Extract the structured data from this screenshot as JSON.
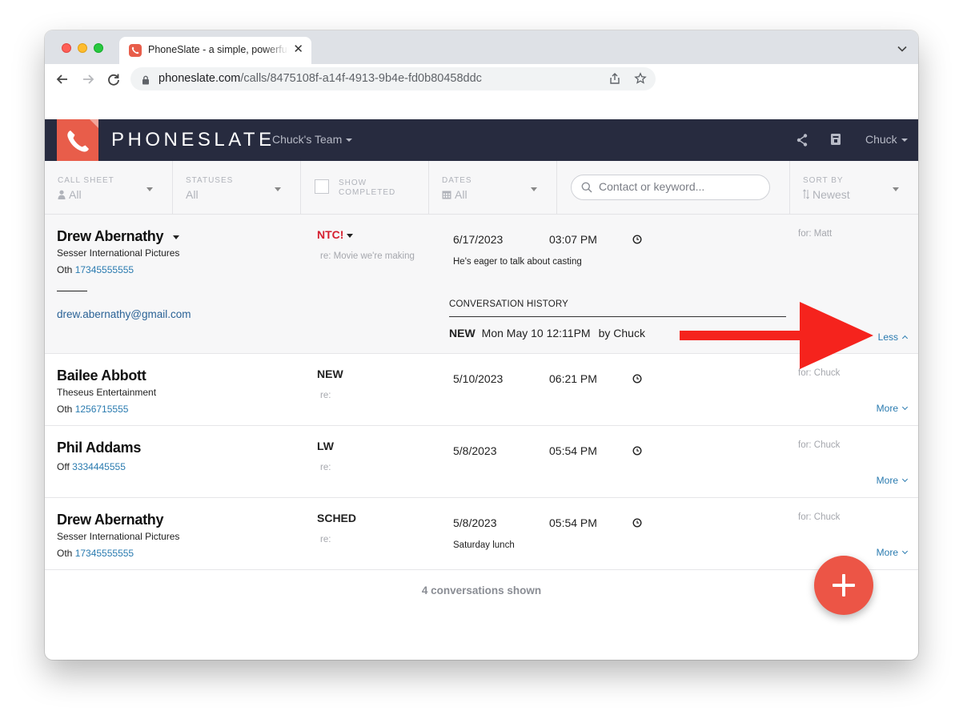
{
  "browser": {
    "tab_title": "PhoneSlate - a simple, powerful",
    "url_host": "phoneslate.com",
    "url_path": "/calls/8475108f-a14f-4913-9b4e-fd0b80458ddc"
  },
  "header": {
    "brand": "PHONESLATE",
    "team": "Chuck's Team",
    "user": "Chuck"
  },
  "filters": {
    "call_sheet": {
      "label": "CALL SHEET",
      "value": "All"
    },
    "statuses": {
      "label": "STATUSES",
      "value": "All"
    },
    "show_completed": {
      "label_line1": "SHOW",
      "label_line2": "COMPLETED",
      "checked": false
    },
    "dates": {
      "label": "DATES",
      "value": "All"
    },
    "search_placeholder": "Contact or keyword...",
    "sort_by": {
      "label": "SORT BY",
      "value": "Newest"
    }
  },
  "calls": [
    {
      "name": "Drew Abernathy",
      "company": "Sesser International Pictures",
      "phone_type": "Oth",
      "phone": "17345555555",
      "status": "NTC!",
      "re": "re: Movie we're making",
      "date": "6/17/2023",
      "time": "03:07 PM",
      "note": "He's eager to talk about casting",
      "for": "for: Matt",
      "toggle": "Less",
      "email": "drew.abernathy@gmail.com",
      "history_label": "CONVERSATION HISTORY",
      "history": [
        {
          "status": "NEW",
          "when": "Mon May 10 12:11PM",
          "by": "by Chuck"
        }
      ]
    },
    {
      "name": "Bailee Abbott",
      "company": "Theseus Entertainment",
      "phone_type": "Oth",
      "phone": "1256715555",
      "status": "NEW",
      "re": "re:",
      "date": "5/10/2023",
      "time": "06:21 PM",
      "note": "",
      "for": "for: Chuck",
      "toggle": "More"
    },
    {
      "name": "Phil Addams",
      "company": "",
      "phone_type": "Off",
      "phone": "3334445555",
      "status": "LW",
      "re": "re:",
      "date": "5/8/2023",
      "time": "05:54 PM",
      "note": "",
      "for": "for: Chuck",
      "toggle": "More"
    },
    {
      "name": "Drew Abernathy",
      "company": "Sesser International Pictures",
      "phone_type": "Oth",
      "phone": "17345555555",
      "status": "SCHED",
      "re": "re:",
      "date": "5/8/2023",
      "time": "05:54 PM",
      "note": "Saturday lunch",
      "for": "for: Chuck",
      "toggle": "More"
    }
  ],
  "footer": {
    "count_text": "4 conversations shown"
  },
  "colors": {
    "header_bg": "#272b3f",
    "brand_accent": "#e85d4a",
    "status_alert": "#d51f2f",
    "link": "#2a7bb0",
    "fab": "#ec5546",
    "annotation_arrow": "#f5231d"
  },
  "icons": [
    "phone-icon",
    "share-icon",
    "archive-icon",
    "user-icon",
    "calendar-icon",
    "search-icon",
    "sort-icon",
    "clock-icon",
    "plus-icon",
    "lock-icon",
    "star-icon"
  ]
}
